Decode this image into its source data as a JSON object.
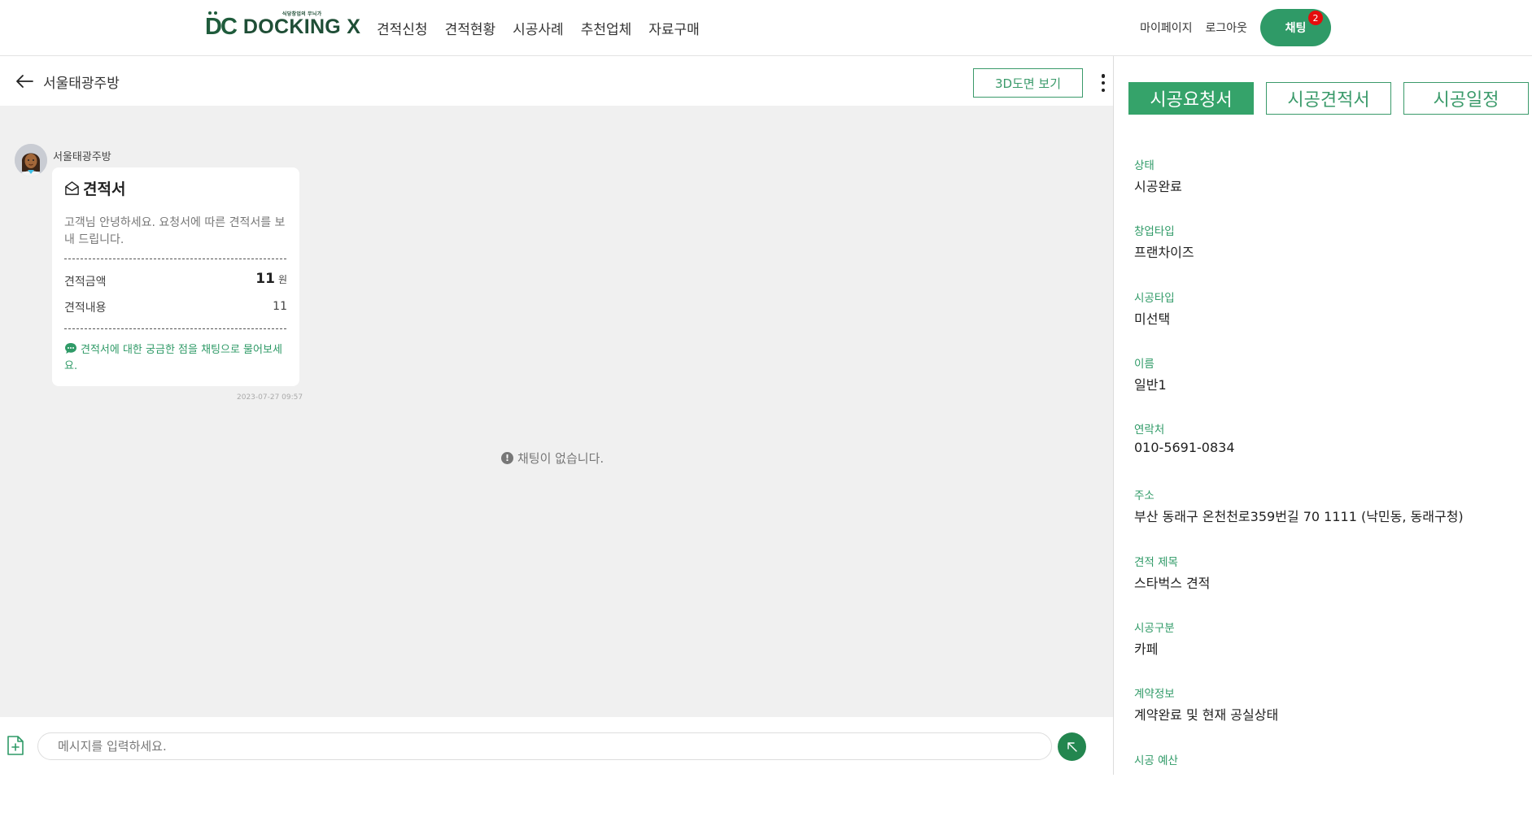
{
  "header": {
    "logo_text": "DOCKING X",
    "logo_tagline": "식당창업의 무늬가",
    "nav": [
      "견적신청",
      "견적현황",
      "시공사례",
      "추천업체",
      "자료구매"
    ],
    "mypage_label": "마이페이지",
    "logout_label": "로그아웃",
    "chat_label": "채팅",
    "chat_badge": "2"
  },
  "chat": {
    "room_title": "서울태광주방",
    "view3d_label": "3D도면 보기",
    "sender_name": "서울태광주방",
    "message": {
      "title": "견적서",
      "description": "고객님 안녕하세요. 요청서에 따른 견적서를 보내 드립니다.",
      "amount_label": "견적금액",
      "amount_value": "11",
      "amount_unit": "원",
      "content_label": "견적내용",
      "content_value": "11",
      "note": "견적서에 대한 궁금한 점을 채팅으로 물어보세요.",
      "timestamp": "2023-07-27 09:57"
    },
    "empty_notice": "채팅이 없습니다.",
    "input_placeholder": "메시지를 입력하세요."
  },
  "right_panel": {
    "tabs": [
      "시공요청서",
      "시공견적서",
      "시공일정"
    ],
    "active_tab": 0,
    "fields": [
      {
        "label": "상태",
        "value": "시공완료"
      },
      {
        "label": "창업타입",
        "value": "프랜차이즈"
      },
      {
        "label": "시공타입",
        "value": "미선택"
      },
      {
        "label": "이름",
        "value": "일반1"
      },
      {
        "label": "연락처",
        "value": "010-5691-0834"
      },
      {
        "label": "주소",
        "value": "부산 동래구 온천천로359번길 70 1111 (낙민동, 동래구청)"
      },
      {
        "label": "견적 제목",
        "value": "스타벅스 견적"
      },
      {
        "label": "시공구분",
        "value": "카페"
      },
      {
        "label": "계약정보",
        "value": "계약완료 및 현재 공실상태"
      },
      {
        "label": "시공 예산",
        "value": ""
      }
    ]
  },
  "colors": {
    "brand_green": "#2f9a67",
    "logo_green": "#1f5c3c",
    "badge_red": "#e50d0d",
    "chat_bg": "#f0f0f0"
  },
  "icons": [
    "arrow-left-icon",
    "more-vertical-icon",
    "envelope-open-icon",
    "chat-bubble-icon",
    "info-icon",
    "file-plus-icon",
    "send-arrow-icon"
  ]
}
